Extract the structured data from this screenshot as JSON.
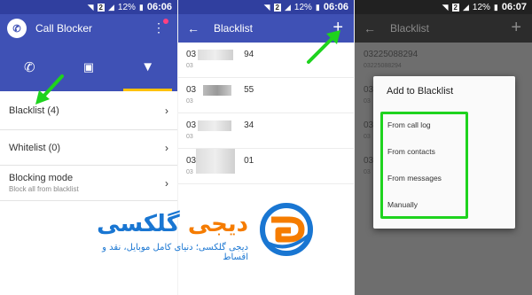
{
  "status_bar": {
    "battery": "12%",
    "sim_badge": "2",
    "times": [
      "06:06",
      "06:06",
      "06:07"
    ]
  },
  "screen1": {
    "app_title": "Call Blocker",
    "tabs": [
      {
        "icon": "phone-icon"
      },
      {
        "icon": "message-icon"
      },
      {
        "icon": "filter-icon"
      }
    ],
    "items": [
      {
        "label": "Blacklist (4)",
        "sub": ""
      },
      {
        "label": "Whitelist (0)",
        "sub": ""
      },
      {
        "label": "Blocking mode",
        "sub": "Block all from blacklist"
      }
    ]
  },
  "screen2": {
    "title": "Blacklist",
    "contacts": [
      {
        "prefix": "03",
        "suffix": "94",
        "sub": "03"
      },
      {
        "prefix": "03",
        "suffix": "55",
        "sub": "03"
      },
      {
        "prefix": "03",
        "suffix": "34",
        "sub": "03"
      },
      {
        "prefix": "03",
        "suffix": "01",
        "sub": "03"
      }
    ]
  },
  "screen3": {
    "title": "Blacklist",
    "rows": [
      {
        "label": "03225088294",
        "sub": "03225088294"
      },
      {
        "label": "03",
        "sub": "03"
      },
      {
        "label": "03",
        "sub": "03"
      },
      {
        "label": "03",
        "sub": "03"
      }
    ],
    "dialog": {
      "title": "Add to Blacklist",
      "options": [
        "From call log",
        "From contacts",
        "From messages",
        "Manually"
      ]
    }
  },
  "watermark": {
    "title_blue": "گلکسی",
    "title_orange": "دیجی",
    "subtitle": "دیجی گلکسی؛ دنیای کامل موبایل، نقد و اقساط"
  },
  "colors": {
    "primary": "#3f51b5",
    "primary_dark": "#303f9f",
    "accent_tab": "#ffc107",
    "highlight": "#1ed31e",
    "brand_blue": "#1976d2",
    "brand_orange": "#f57c00"
  }
}
